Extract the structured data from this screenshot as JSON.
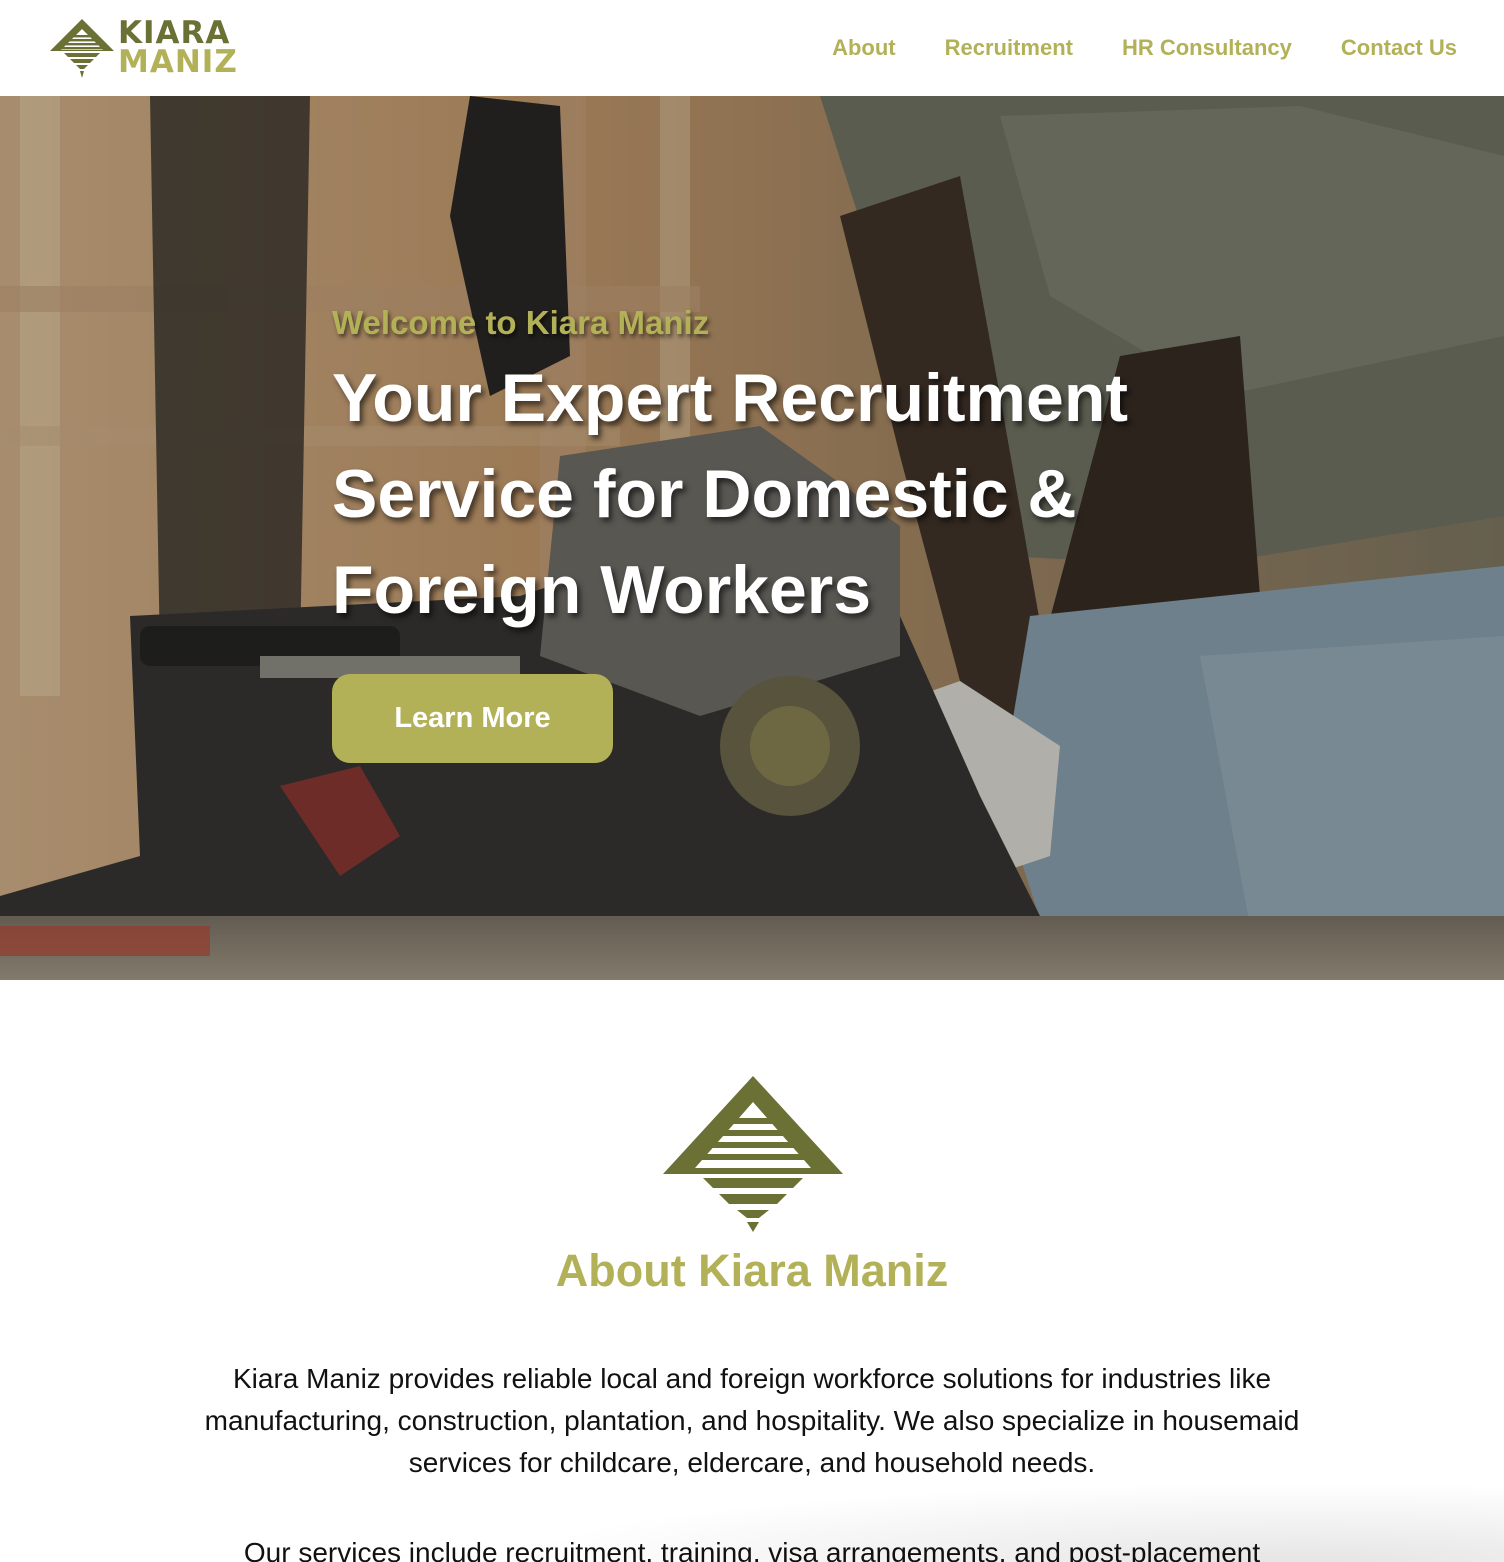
{
  "brand": {
    "name_line1": "KIARA",
    "name_line2": "MANIZ",
    "colors": {
      "olive_dark": "#6b7035",
      "olive_light": "#b3b158"
    },
    "logo_icon": "pyramid-tree-icon"
  },
  "nav": {
    "items": [
      {
        "label": "About"
      },
      {
        "label": "Recruitment"
      },
      {
        "label": "HR Consultancy"
      },
      {
        "label": "Contact Us"
      }
    ]
  },
  "hero": {
    "eyebrow": "Welcome to Kiara Maniz",
    "title": "Your Expert Recruitment Service for Domestic & Foreign Workers",
    "cta_label": "Learn More",
    "background_image": "worker-cutting-wood-with-miter-saw"
  },
  "about": {
    "title": "About Kiara Maniz",
    "paragraph1": "Kiara Maniz provides reliable local and foreign workforce solutions for industries like manufacturing, construction, plantation, and hospitality. We also specialize in housemaid services for childcare, eldercare, and household needs.",
    "paragraph2": "Our services include recruitment, training, visa arrangements, and post-placement"
  }
}
